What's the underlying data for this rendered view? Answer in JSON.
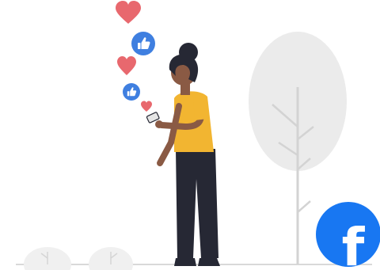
{
  "illustration": {
    "subject": "woman-using-phone-social-media",
    "icons": [
      "heart-icon",
      "like-icon",
      "heart-icon",
      "like-icon",
      "heart-icon"
    ]
  },
  "facebook_badge": {
    "letter": "f",
    "color": "#1877F2"
  },
  "colors": {
    "heart": "#E8686E",
    "like_badge": "#3F7FE0",
    "shirt": "#F2B531",
    "pants": "#262834",
    "skin": "#8A5A44",
    "hair": "#262834",
    "tree": "#EBEBEB",
    "tree_branch": "#D3D3D3",
    "ground": "#D9D9D9",
    "facebook": "#1877F2"
  }
}
